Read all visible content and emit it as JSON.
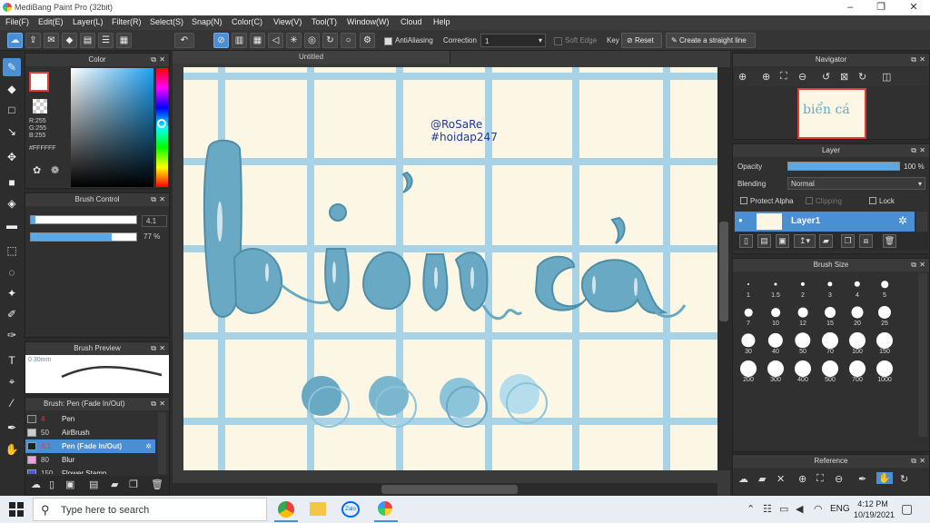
{
  "window": {
    "title": "MediBang Paint Pro (32bit)"
  },
  "menu": [
    "File(F)",
    "Edit(E)",
    "Layer(L)",
    "Filter(R)",
    "Select(S)",
    "Snap(N)",
    "Color(C)",
    "View(V)",
    "Tool(T)",
    "Window(W)",
    "Cloud",
    "Help"
  ],
  "toolbar": {
    "antialiasing_label": "AntiAliasing",
    "correction_label": "Correction",
    "correction_value": "1",
    "soft_edge_label": "Soft Edge",
    "key_label": "Key",
    "reset_label": "Reset",
    "straight_line_label": "Create a straight line"
  },
  "color_panel": {
    "title": "Color",
    "r": "R:255",
    "g": "G:255",
    "b": "B:255",
    "hex": "#FFFFFF",
    "fg_color": "#ffffff",
    "accent": "#e53935"
  },
  "brush_control": {
    "title": "Brush Control",
    "size_value": "4.1",
    "opacity_value": "77 %",
    "opacity_fraction": 0.77
  },
  "brush_preview": {
    "title": "Brush Preview",
    "size_label": "0.30mm"
  },
  "brush_list": {
    "title": "Brush: Pen (Fade In/Out)",
    "items": [
      {
        "size": "4",
        "name": "Pen",
        "swatch": "#3a3a3a"
      },
      {
        "size": "50",
        "name": "AirBrush",
        "swatch": "#cccccc"
      },
      {
        "size": "4.1",
        "name": "Pen (Fade In/Out)",
        "swatch": "#222222"
      },
      {
        "size": "80",
        "name": "Blur",
        "swatch": "#f0a0e0"
      },
      {
        "size": "150",
        "name": "Flower Stamp",
        "swatch": "#4a5ad8"
      }
    ]
  },
  "document": {
    "tab_title": "Untitled",
    "watermark_line1": "@RoSaRe",
    "watermark_line2": "#hoidap247",
    "artwork_text": "biển cá"
  },
  "navigator": {
    "title": "Navigator",
    "thumb_text": "biển cá"
  },
  "layer_panel": {
    "title": "Layer",
    "opacity_label": "Opacity",
    "opacity_value": "100 %",
    "blending_label": "Blending",
    "blending_value": "Normal",
    "protect_alpha_label": "Protect Alpha",
    "clipping_label": "Clipping",
    "lock_label": "Lock",
    "layer_name": "Layer1"
  },
  "brush_size": {
    "title": "Brush Size",
    "sizes": [
      "1",
      "1.5",
      "2",
      "3",
      "4",
      "5",
      "7",
      "10",
      "12",
      "15",
      "20",
      "25",
      "30",
      "40",
      "50",
      "70",
      "100",
      "150",
      "200",
      "300",
      "400",
      "500",
      "700",
      "1000"
    ]
  },
  "reference": {
    "title": "Reference"
  },
  "taskbar": {
    "search_placeholder": "Type here to search",
    "lang": "ENG",
    "time": "4:12 PM",
    "date": "10/19/2021"
  }
}
